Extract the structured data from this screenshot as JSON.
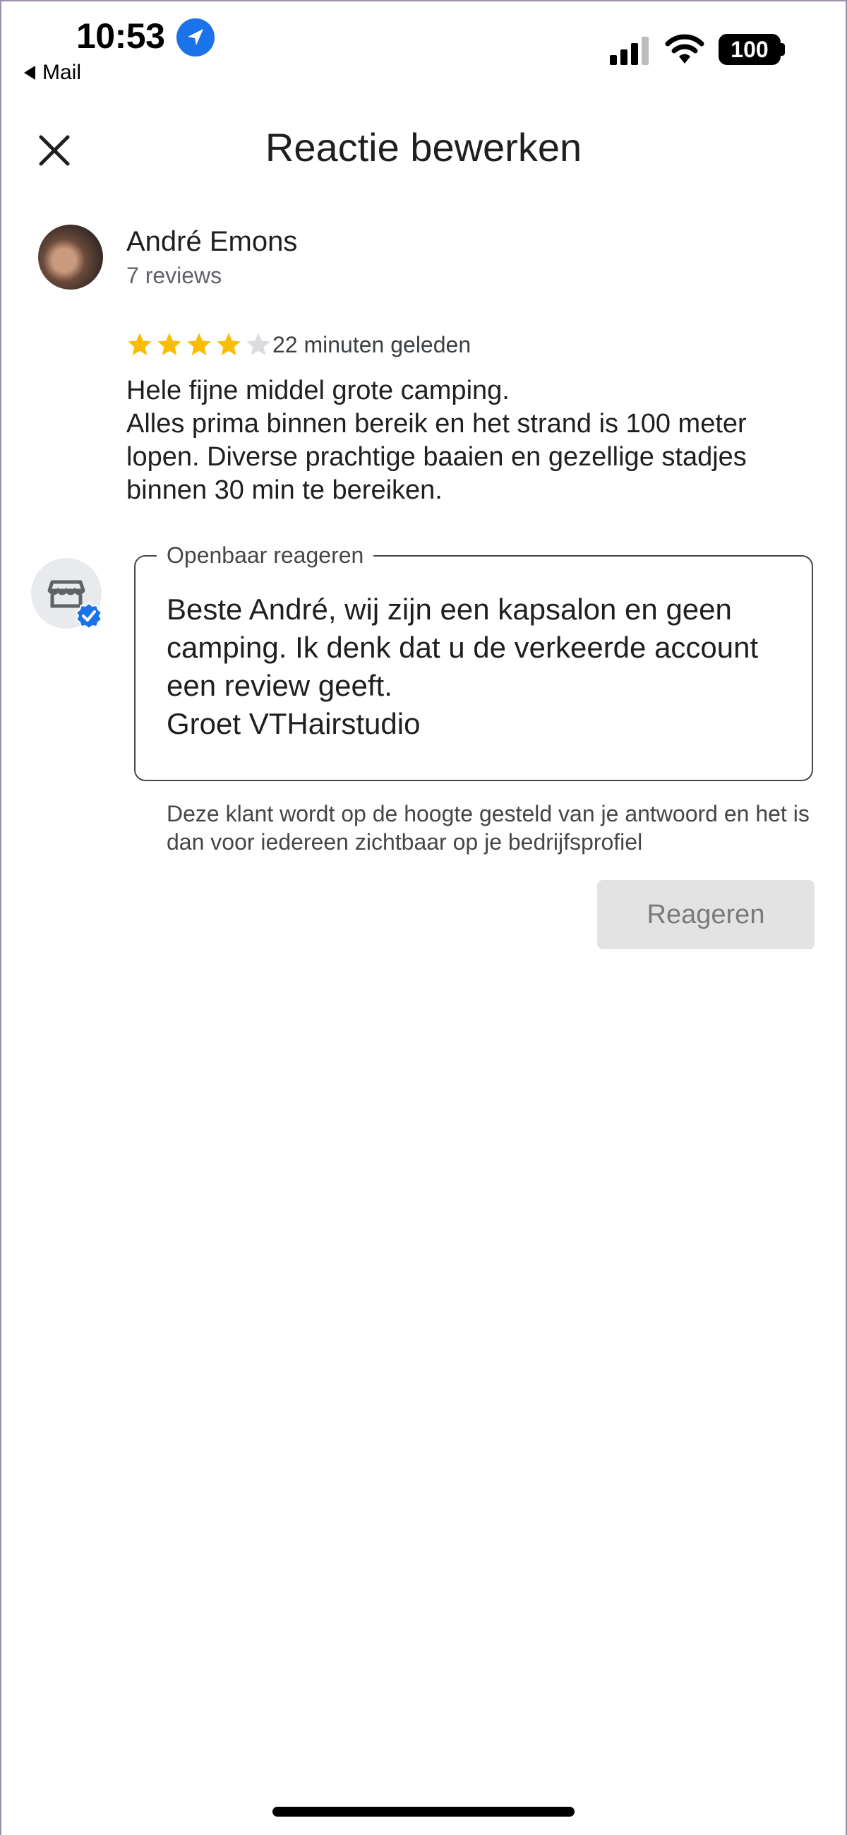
{
  "status_bar": {
    "time": "10:53",
    "back_app": "Mail",
    "battery": "100"
  },
  "header": {
    "title": "Reactie bewerken"
  },
  "review": {
    "reviewer_name": "André Emons",
    "reviewer_count": "7 reviews",
    "rating": 4,
    "max_rating": 5,
    "time_ago": "22 minuten geleden",
    "text": "Hele fijne middel grote camping.\nAlles prima binnen bereik en het strand is 100 meter lopen. Diverse prachtige baaien en gezellige stadjes binnen 30 min te bereiken."
  },
  "reply": {
    "label": "Openbaar reageren",
    "value": "Beste André, wij zijn een kapsalon en geen camping. Ik denk dat u de verkeerde account een review geeft.\nGroet VTHairstudio",
    "helper": "Deze klant wordt op de hoogte gesteld van je antwoord en het is dan voor iedereen zichtbaar op je bedrijfsprofiel",
    "submit_label": "Reageren"
  },
  "colors": {
    "star_filled": "#fbbc04",
    "star_empty": "#dadce0",
    "verified": "#1a73e8",
    "button_disabled_bg": "#e3e3e3"
  }
}
